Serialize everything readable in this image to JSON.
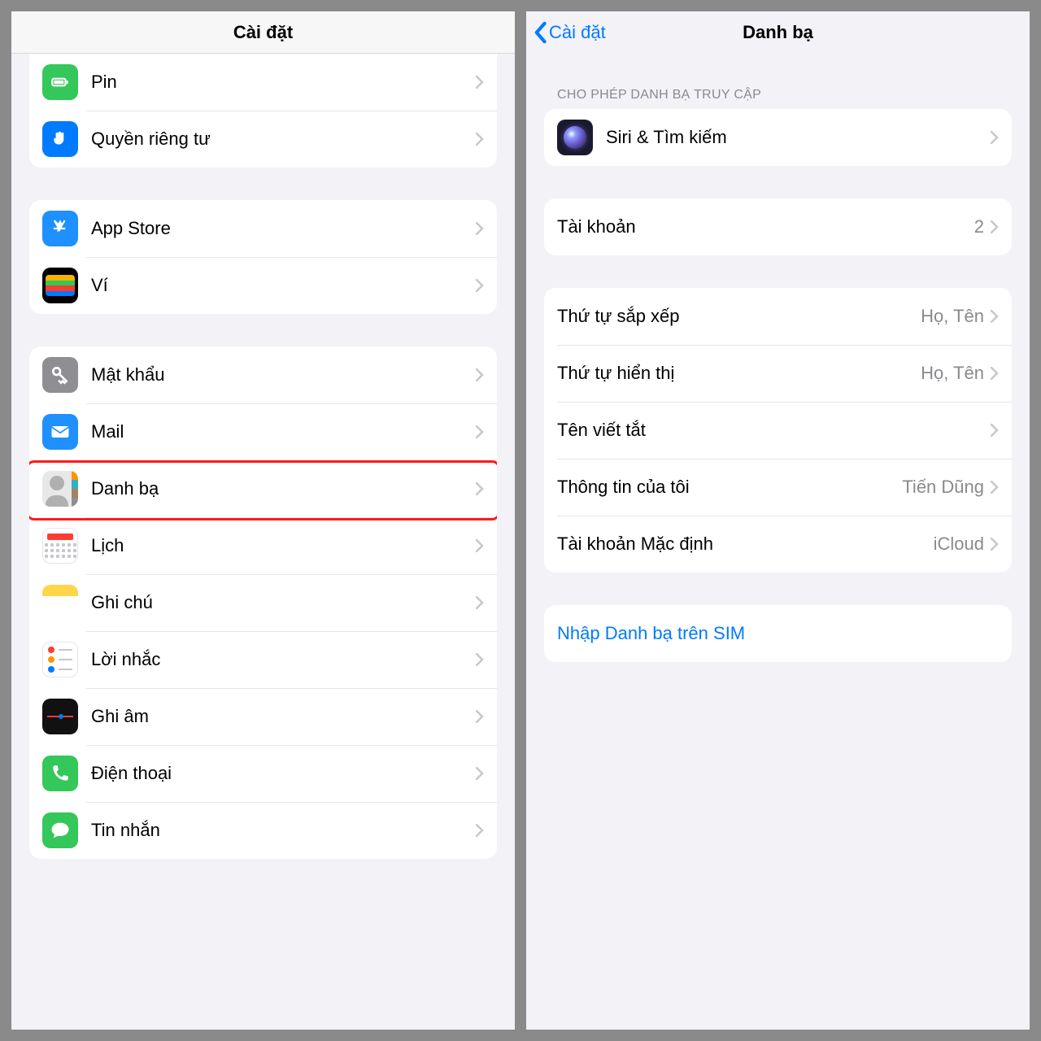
{
  "left": {
    "title": "Cài đặt",
    "groups": [
      {
        "rows": [
          {
            "id": "battery",
            "label": "Pin"
          },
          {
            "id": "privacy",
            "label": "Quyền riêng tư"
          }
        ]
      },
      {
        "rows": [
          {
            "id": "appstore",
            "label": "App Store"
          },
          {
            "id": "wallet",
            "label": "Ví"
          }
        ]
      },
      {
        "rows": [
          {
            "id": "passwords",
            "label": "Mật khẩu"
          },
          {
            "id": "mail",
            "label": "Mail"
          },
          {
            "id": "contacts",
            "label": "Danh bạ",
            "highlight": true
          },
          {
            "id": "calendar",
            "label": "Lịch"
          },
          {
            "id": "notes",
            "label": "Ghi chú"
          },
          {
            "id": "reminders",
            "label": "Lời nhắc"
          },
          {
            "id": "voicememo",
            "label": "Ghi âm"
          },
          {
            "id": "phone",
            "label": "Điện thoại"
          },
          {
            "id": "messages",
            "label": "Tin nhắn"
          }
        ]
      }
    ]
  },
  "right": {
    "back": "Cài đặt",
    "title": "Danh bạ",
    "section_header": "CHO PHÉP DANH BẠ TRUY CẬP",
    "siri_row": {
      "label": "Siri & Tìm kiếm"
    },
    "accounts": {
      "label": "Tài khoản",
      "value": "2"
    },
    "sort_order": {
      "label": "Thứ tự sắp xếp",
      "value": "Họ, Tên"
    },
    "display_order": {
      "label": "Thứ tự hiển thị",
      "value": "Họ, Tên"
    },
    "short_name": {
      "label": "Tên viết tắt"
    },
    "my_info": {
      "label": "Thông tin của tôi",
      "value": "Tiến Dũng"
    },
    "default_account": {
      "label": "Tài khoản Mặc định",
      "value": "iCloud"
    },
    "import_sim": {
      "label": "Nhập Danh bạ trên SIM",
      "highlight": true
    }
  }
}
